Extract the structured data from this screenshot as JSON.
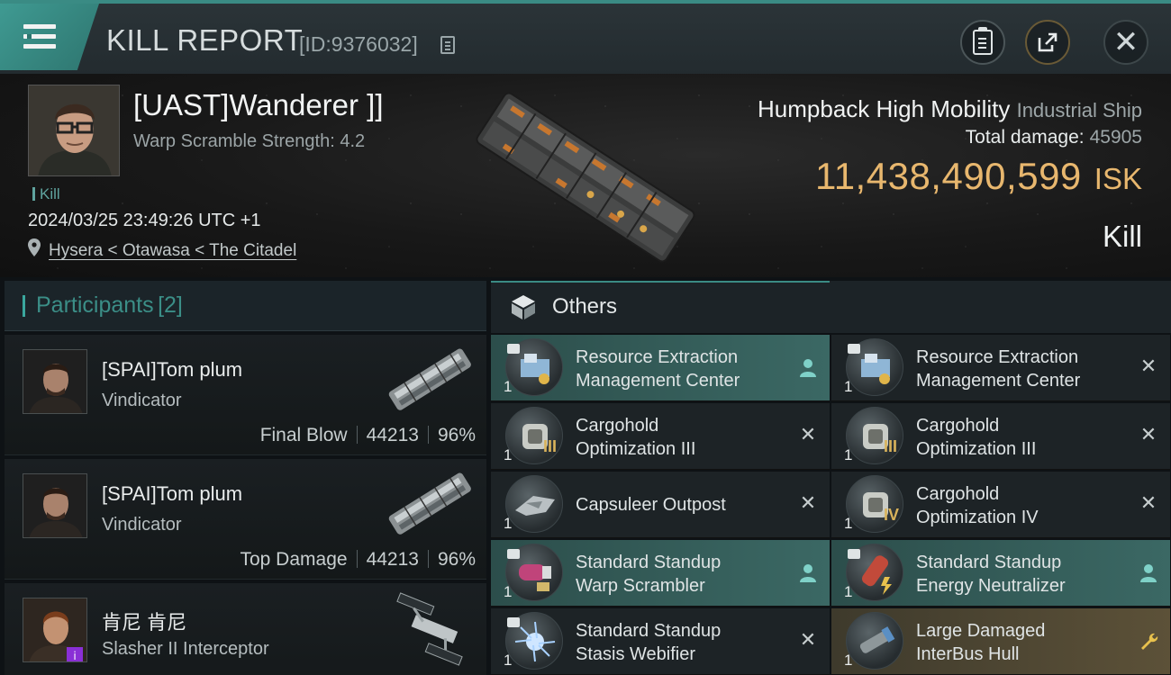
{
  "header": {
    "title": "KILL REPORT",
    "report_id": "[ID:9376032]",
    "icons": [
      "menu-icon",
      "copy-icon",
      "clipboard-icon",
      "share-icon",
      "close-icon"
    ]
  },
  "victim": {
    "pilot": "[UAST]Wanderer ]]",
    "warp_scramble": "Warp Scramble Strength: 4.2",
    "kill_tag": "Kill",
    "timestamp": "2024/03/25 23:49:26 UTC +1",
    "location": "Hysera < Otawasa < The Citadel",
    "ship_name": "Humpback High Mobility",
    "ship_class": "Industrial Ship",
    "total_damage_label": "Total damage:",
    "total_damage": "45905",
    "isk_value": "11,438,490,599",
    "isk_currency": "ISK",
    "result": "Kill"
  },
  "participants": {
    "label": "Participants",
    "count": "[2]",
    "list": [
      {
        "name": "[SPAI]Tom plum",
        "ship": "Vindicator",
        "role": "Final Blow",
        "damage": "44213",
        "percent": "96%"
      },
      {
        "name": "[SPAI]Tom plum",
        "ship": "Vindicator",
        "role": "Top Damage",
        "damage": "44213",
        "percent": "96%"
      },
      {
        "name": "肯尼 肯尼",
        "ship": "Slasher II Interceptor",
        "role": "",
        "damage": "",
        "percent": ""
      }
    ]
  },
  "others": {
    "label": "Others",
    "items": [
      {
        "name": "Resource Extraction Management Center",
        "line1": "Resource Extraction",
        "line2": "Management Center",
        "qty": "1",
        "level": "",
        "state": "dropped",
        "action": "person-icon"
      },
      {
        "name": "Resource Extraction Management Center",
        "line1": "Resource Extraction",
        "line2": "Management Center",
        "qty": "1",
        "level": "",
        "state": "destroyed",
        "action": "close-icon"
      },
      {
        "name": "Cargohold Optimization III",
        "line1": "Cargohold",
        "line2": "Optimization III",
        "qty": "1",
        "level": "III",
        "state": "destroyed",
        "action": "close-icon"
      },
      {
        "name": "Cargohold Optimization III",
        "line1": "Cargohold",
        "line2": "Optimization III",
        "qty": "1",
        "level": "III",
        "state": "destroyed",
        "action": "close-icon"
      },
      {
        "name": "Capsuleer Outpost",
        "line1": "Capsuleer Outpost",
        "line2": "",
        "qty": "1",
        "level": "",
        "state": "destroyed",
        "action": "close-icon"
      },
      {
        "name": "Cargohold Optimization IV",
        "line1": "Cargohold",
        "line2": "Optimization IV",
        "qty": "1",
        "level": "IV",
        "state": "destroyed",
        "action": "close-icon"
      },
      {
        "name": "Standard Standup Warp Scrambler",
        "line1": "Standard Standup",
        "line2": "Warp Scrambler",
        "qty": "1",
        "level": "",
        "state": "dropped",
        "action": "person-icon"
      },
      {
        "name": "Standard Standup Energy Neutralizer",
        "line1": "Standard Standup",
        "line2": "Energy Neutralizer",
        "qty": "1",
        "level": "",
        "state": "dropped",
        "action": "person-icon"
      },
      {
        "name": "Standard Standup Stasis Webifier",
        "line1": "Standard Standup",
        "line2": "Stasis Webifier",
        "qty": "1",
        "level": "",
        "state": "destroyed",
        "action": "close-icon"
      },
      {
        "name": "Large Damaged InterBus Hull",
        "line1": "Large Damaged",
        "line2": "InterBus Hull",
        "qty": "1",
        "level": "",
        "state": "salvage",
        "action": "wrench-icon"
      }
    ]
  },
  "colors": {
    "accent": "#3a8b84",
    "isk": "#e8b76e",
    "dropped_row": "#3b6864",
    "salvage_row": "#5c5138"
  }
}
